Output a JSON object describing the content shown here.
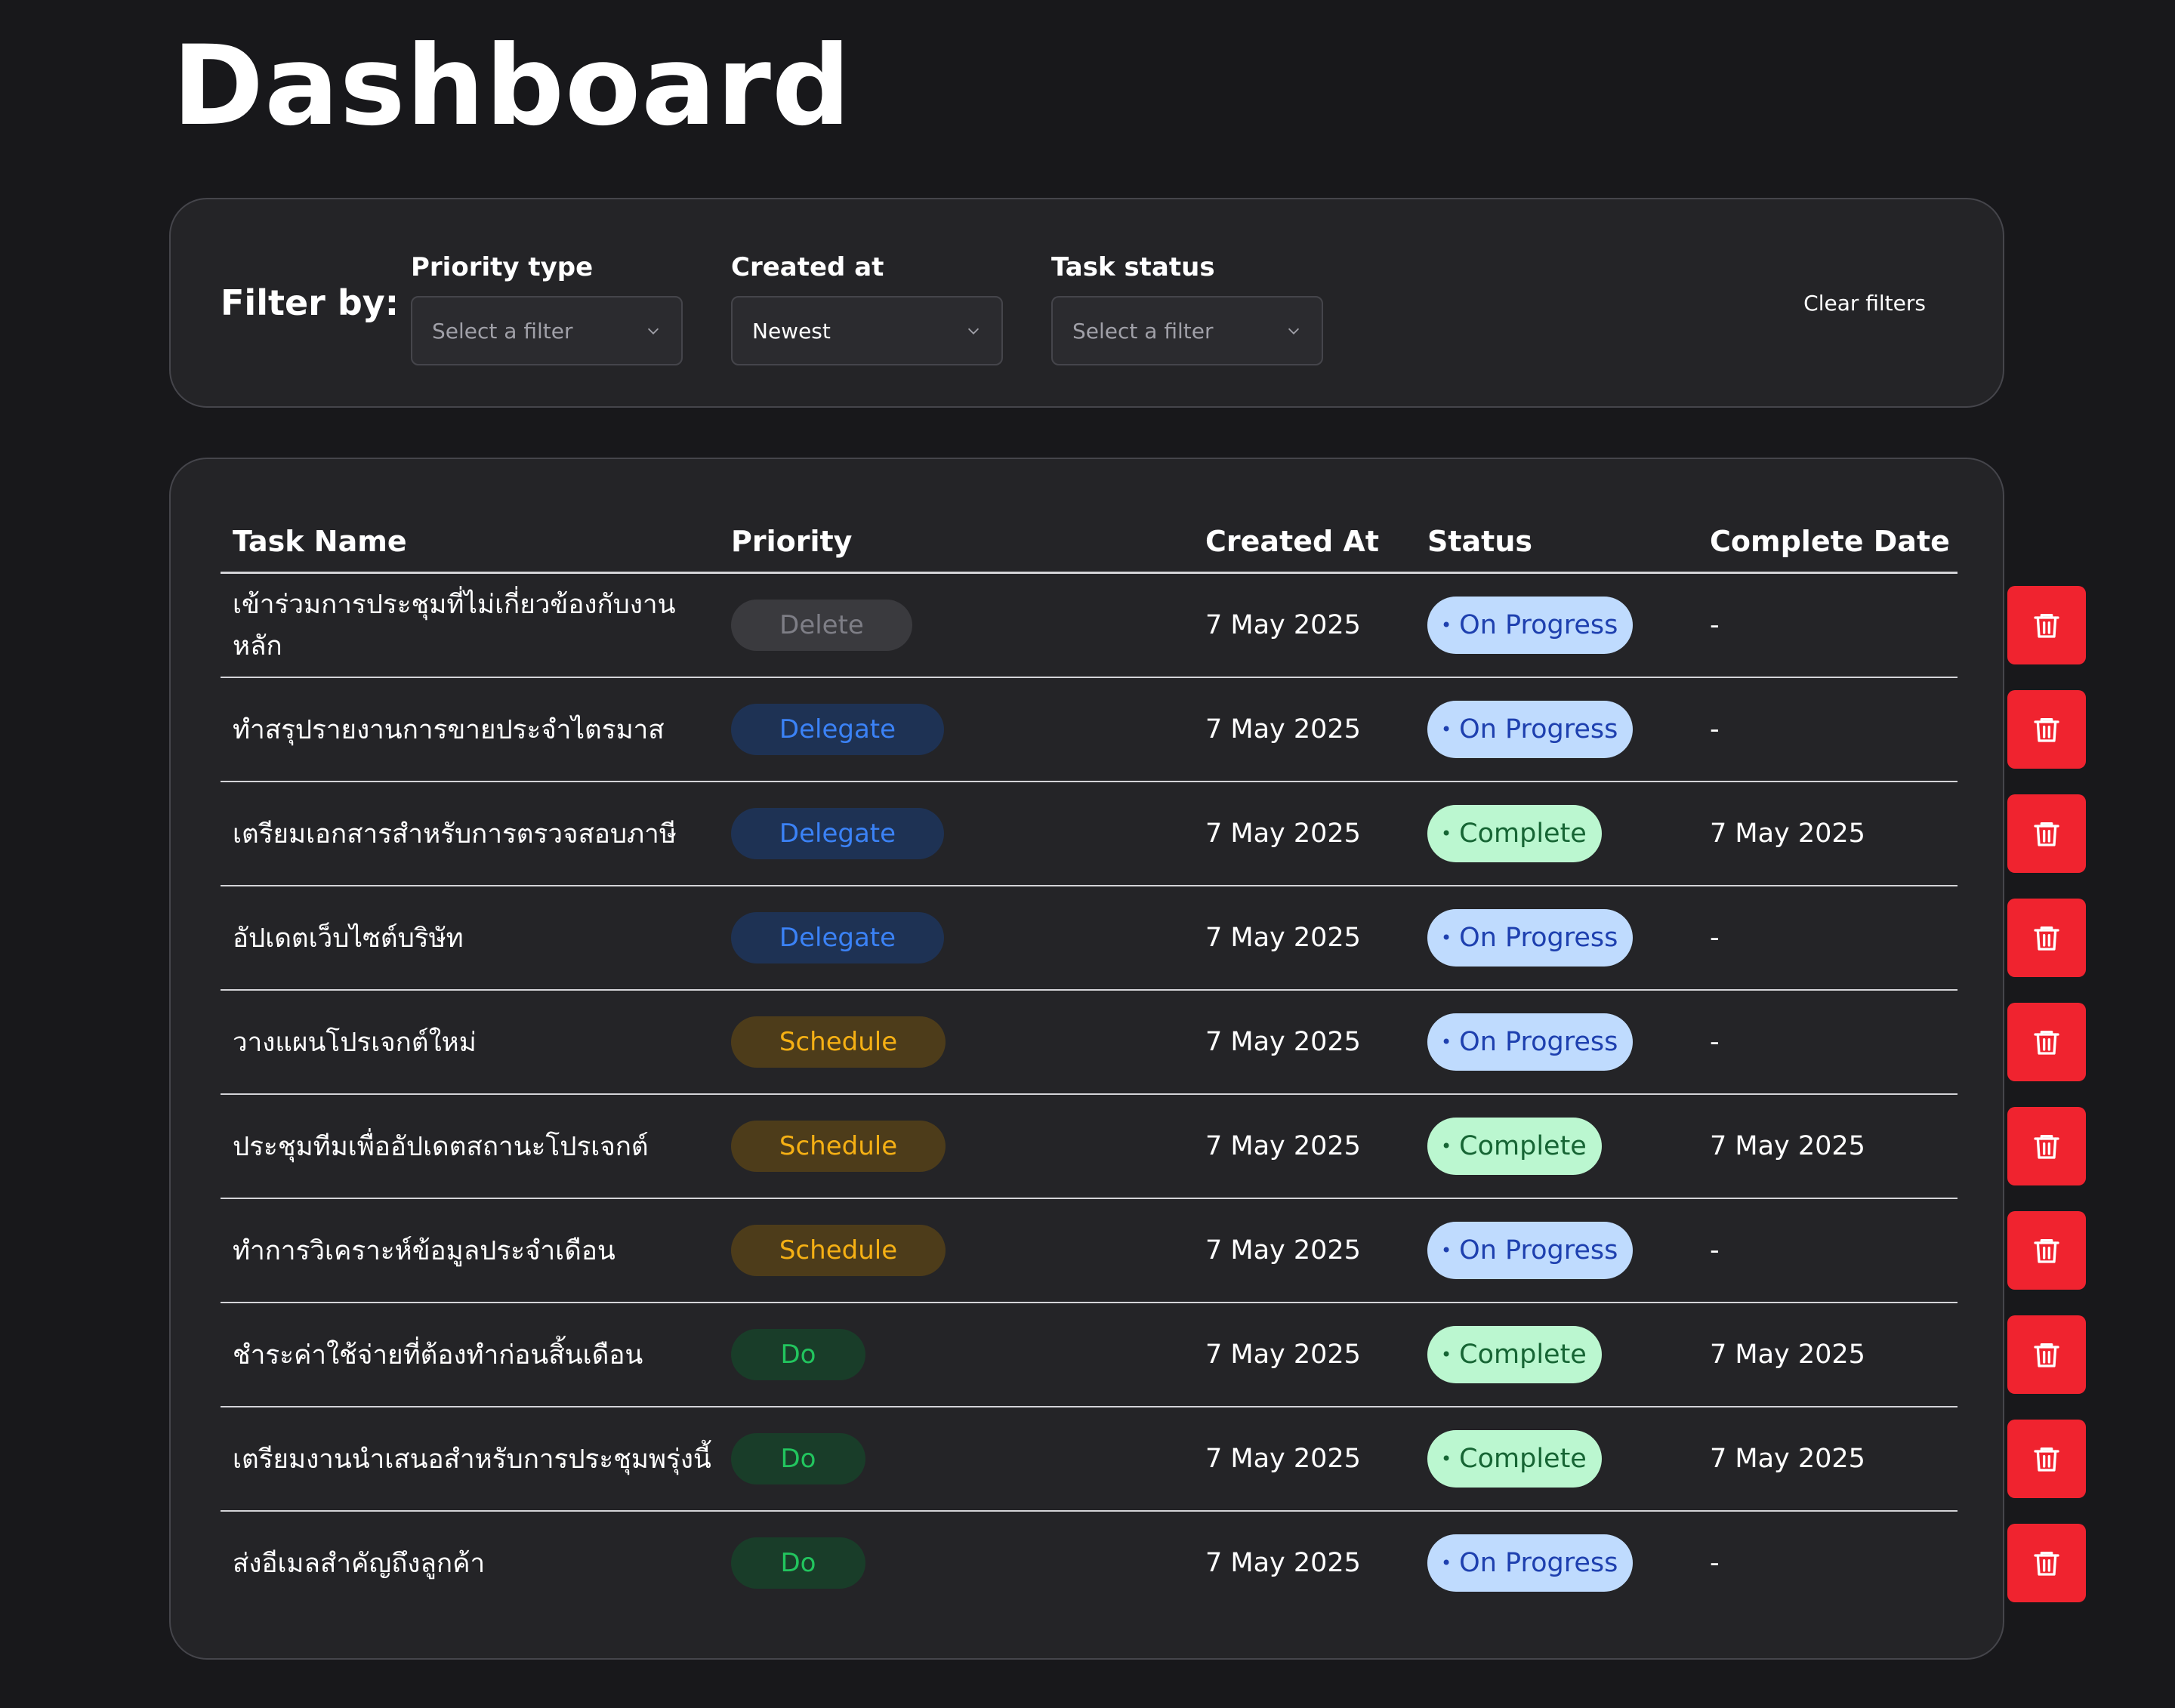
{
  "page": {
    "title": "Dashboard"
  },
  "filters": {
    "label": "Filter by:",
    "priority_type": {
      "label": "Priority type",
      "value": "Select a filter"
    },
    "created_at": {
      "label": "Created at",
      "value": "Newest"
    },
    "task_status": {
      "label": "Task status",
      "value": "Select a filter"
    },
    "clear_label": "Clear filters"
  },
  "table": {
    "headers": {
      "task_name": "Task Name",
      "priority": "Priority",
      "created_at": "Created At",
      "status": "Status",
      "complete_date": "Complete Date"
    },
    "rows": [
      {
        "name": "เข้าร่วมการประชุมที่ไม่เกี่ยวข้องกับงานหลัก",
        "priority": "Delete",
        "priority_kind": "delete",
        "created": "7 May 2025",
        "status": "On Progress",
        "status_kind": "progress",
        "complete": "-"
      },
      {
        "name": "ทำสรุปรายงานการขายประจำไตรมาส",
        "priority": "Delegate",
        "priority_kind": "delegate",
        "created": "7 May 2025",
        "status": "On Progress",
        "status_kind": "progress",
        "complete": "-"
      },
      {
        "name": "เตรียมเอกสารสำหรับการตรวจสอบภาษี",
        "priority": "Delegate",
        "priority_kind": "delegate",
        "created": "7 May 2025",
        "status": "Complete",
        "status_kind": "complete",
        "complete": "7 May 2025"
      },
      {
        "name": "อัปเดตเว็บไซต์บริษัท",
        "priority": "Delegate",
        "priority_kind": "delegate",
        "created": "7 May 2025",
        "status": "On Progress",
        "status_kind": "progress",
        "complete": "-"
      },
      {
        "name": "วางแผนโปรเจกต์ใหม่",
        "priority": "Schedule",
        "priority_kind": "schedule",
        "created": "7 May 2025",
        "status": "On Progress",
        "status_kind": "progress",
        "complete": "-"
      },
      {
        "name": "ประชุมทีมเพื่ออัปเดตสถานะโปรเจกต์",
        "priority": "Schedule",
        "priority_kind": "schedule",
        "created": "7 May 2025",
        "status": "Complete",
        "status_kind": "complete",
        "complete": "7 May 2025"
      },
      {
        "name": "ทำการวิเคราะห์ข้อมูลประจำเดือน",
        "priority": "Schedule",
        "priority_kind": "schedule",
        "created": "7 May 2025",
        "status": "On Progress",
        "status_kind": "progress",
        "complete": "-"
      },
      {
        "name": "ชำระค่าใช้จ่ายที่ต้องทำก่อนสิ้นเดือน",
        "priority": "Do",
        "priority_kind": "do",
        "created": "7 May 2025",
        "status": "Complete",
        "status_kind": "complete",
        "complete": "7 May 2025"
      },
      {
        "name": "เตรียมงานนำเสนอสำหรับการประชุมพรุ่งนี้",
        "priority": "Do",
        "priority_kind": "do",
        "created": "7 May 2025",
        "status": "Complete",
        "status_kind": "complete",
        "complete": "7 May 2025"
      },
      {
        "name": "ส่งอีเมลสำคัญถึงลูกค้า",
        "priority": "Do",
        "priority_kind": "do",
        "created": "7 May 2025",
        "status": "On Progress",
        "status_kind": "progress",
        "complete": "-"
      }
    ]
  },
  "icons": {
    "dropdown": "chevron-down-icon",
    "delete": "trash-icon",
    "status": "dot-icon"
  },
  "colors": {
    "background": "#18181b",
    "card": "#242427",
    "delete_button": "#f0232f",
    "delegate": "#3b82f6",
    "schedule": "#f5b014",
    "do": "#22c55e",
    "on_progress_bg": "#bfdbfe",
    "complete_bg": "#bbf7d0"
  }
}
